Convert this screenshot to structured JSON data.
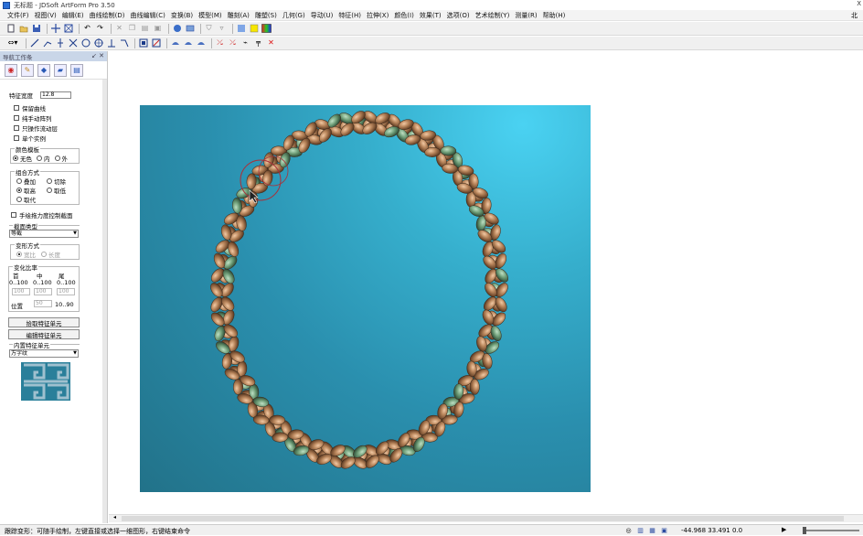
{
  "window": {
    "title": "无标题 - JDSoft ArtForm Pro 3.50",
    "close_label": "X"
  },
  "menu": {
    "items": [
      "文件(F)",
      "视图(V)",
      "编辑(E)",
      "曲线绘制(D)",
      "曲线编辑(C)",
      "变换(B)",
      "模型(M)",
      "雕刻(A)",
      "雕塑(S)",
      "几何(G)",
      "导动(U)",
      "特征(H)",
      "拉伸(X)",
      "颜色(I)",
      "效果(T)",
      "选项(O)",
      "艺术绘制(Y)",
      "测量(R)",
      "帮助(H)"
    ],
    "right": "北"
  },
  "toolbar1": {
    "icons": [
      "new-icon",
      "open-icon",
      "save-icon",
      "grid-icon",
      "frame-icon",
      "undo-icon",
      "redo-icon",
      "cut-icon",
      "copy-icon",
      "paste-icon",
      "print-icon",
      "sphere-icon",
      "view-icon",
      "shield-icon",
      "cup-icon",
      "palette-icon",
      "yellow-color-icon",
      "gradient-color-icon"
    ]
  },
  "toolbar2": {
    "icons": [
      "arrows-icon",
      "line-icon",
      "polyline-icon",
      "vertical-icon",
      "cross-icon",
      "circle-icon",
      "circle-cross-icon",
      "t-icon",
      "scissors-icon",
      "select-icon",
      "measure-icon",
      "snap1-icon",
      "snap2-icon",
      "snap3-icon",
      "tool1-icon",
      "tool2-icon",
      "brush-icon",
      "dropper-icon",
      "delete-icon"
    ]
  },
  "panel": {
    "title": "导航工作条",
    "feature_width_label": "特征宽度",
    "feature_width_value": "12.8",
    "checkbox_keep_curve": "保留曲线",
    "checkbox_manual_array": "纯手动阵列",
    "checkbox_operate_on_layer": "只操作流动层",
    "checkbox_single_instance": "单个实例",
    "color_template": {
      "label": "颜色模板",
      "options": [
        "无色",
        "内",
        "外"
      ],
      "selected": 0
    },
    "combine_mode": {
      "label": "组合方式",
      "options": [
        "叠加",
        "切除",
        "取高",
        "取低",
        "取代"
      ],
      "selected": 2
    },
    "checkbox_hand_draw_ctrl": "手绘拖力度控制截面",
    "section_type": {
      "label": "截面类型",
      "value": "等截"
    },
    "deform_mode": {
      "label": "变形方式",
      "options": [
        "宽比",
        "长度"
      ]
    },
    "ratio": {
      "label": "变化比率",
      "cols": [
        "首",
        "中",
        "尾"
      ],
      "ranges": [
        "0..100",
        "0..100",
        "0..100"
      ],
      "values": [
        "100",
        "100",
        "100"
      ],
      "position_label": "位置",
      "position_value": "50",
      "position_range": "10..90"
    },
    "btn_pick_feature": "拾取特征单元",
    "btn_edit_feature": "编辑特征单元",
    "builtin_feature": {
      "label": "内置特征单元",
      "value": "万字纹"
    }
  },
  "status": {
    "message": "跟踪变形：可随手绘制，左键直接或选择一维图形，右键结束命令",
    "coords": "-44.968 33.491 0.0",
    "icons": [
      "nav-icon",
      "layers-icon",
      "grid-icon",
      "window-icon"
    ]
  },
  "colors": {
    "viewport_top": "#4ad2f2",
    "viewport_bottom": "#227289",
    "braid_copper": "#b9865c",
    "braid_green": "#5c8f6e"
  }
}
